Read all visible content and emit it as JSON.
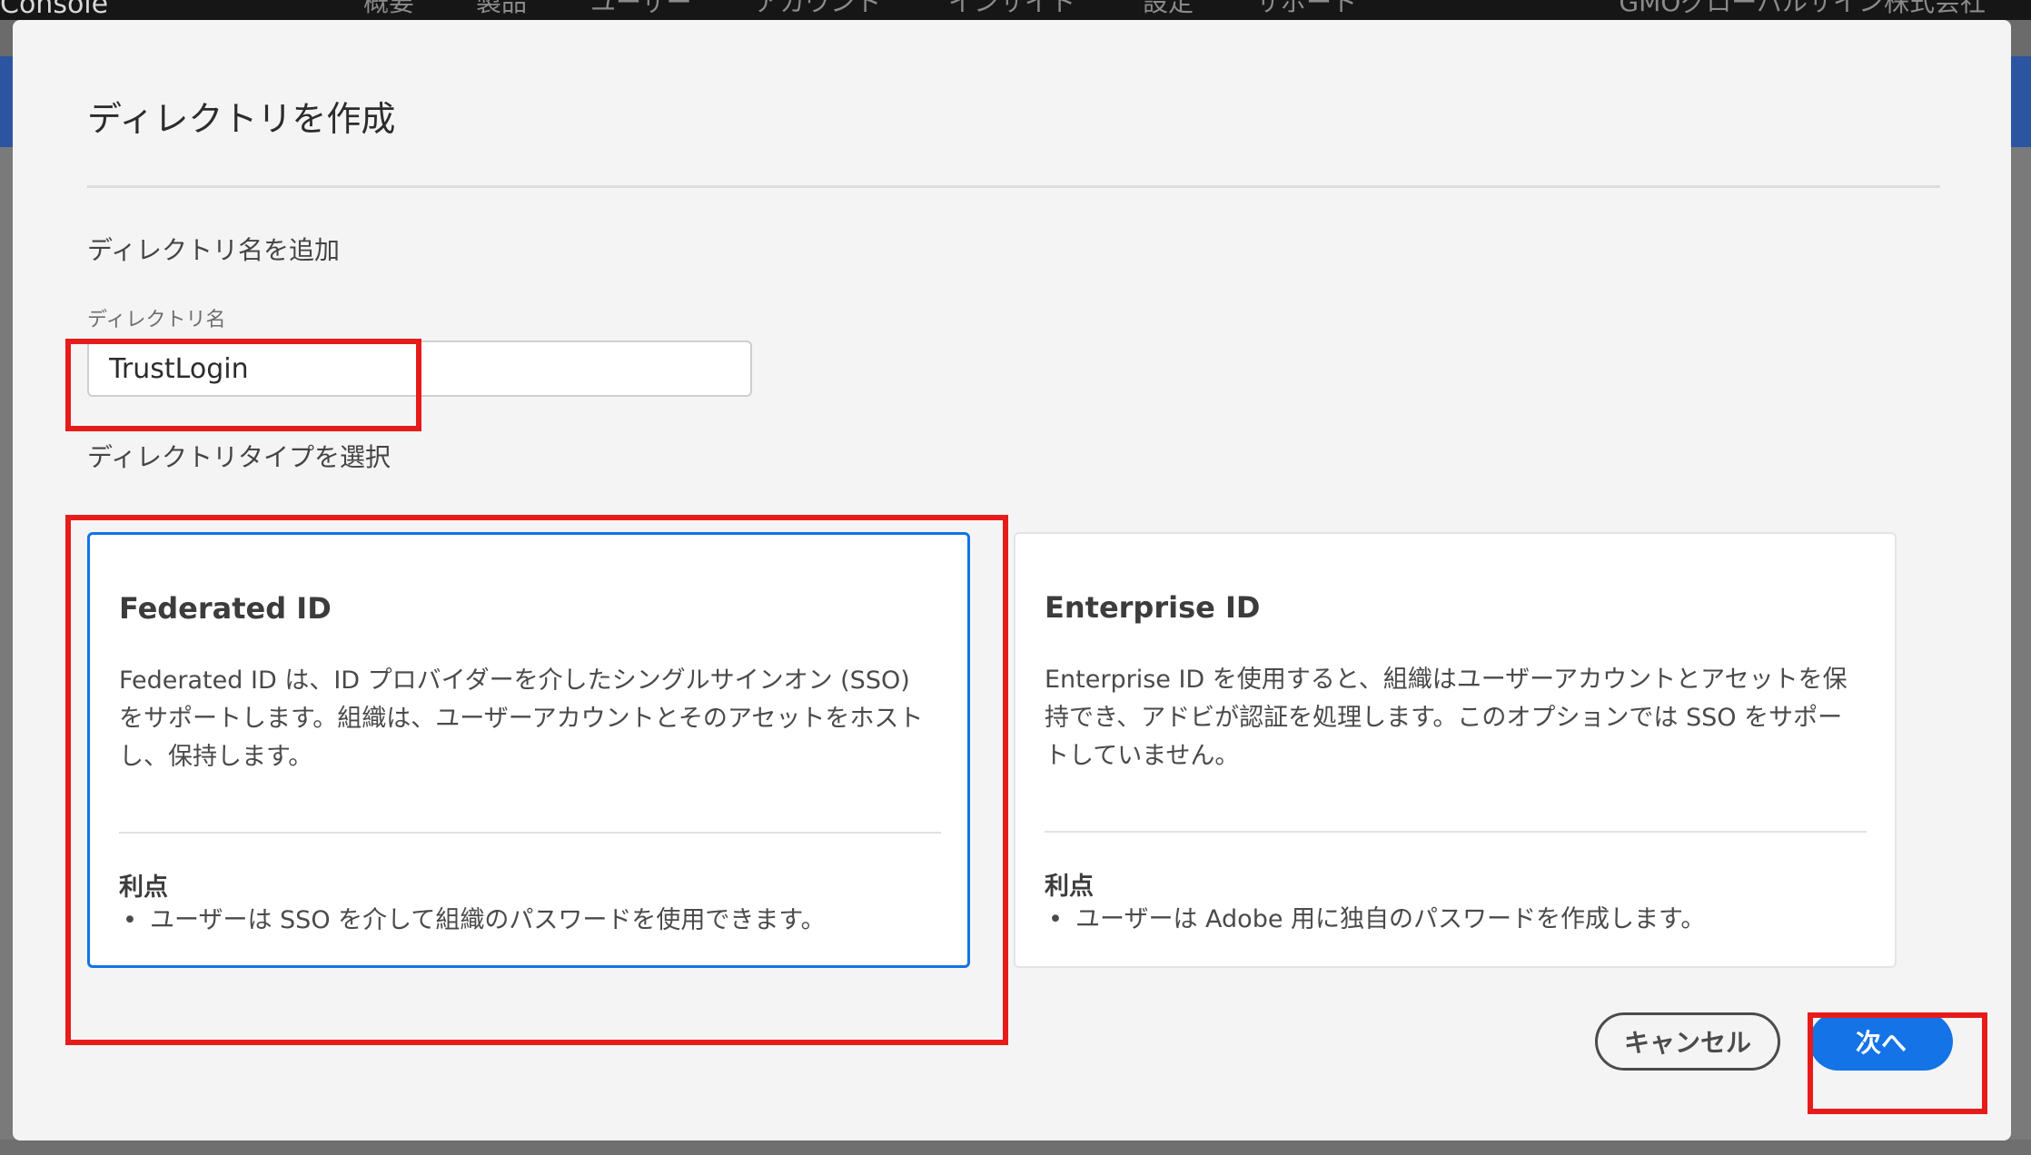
{
  "background": {
    "app_name": "Console",
    "nav": [
      "概要",
      "製品",
      "ユーザー",
      "アカウント",
      "インサイト",
      "設定",
      "サポート"
    ],
    "org_name": "GMOグローバルサイン株式会社"
  },
  "modal": {
    "title": "ディレクトリを作成",
    "name_section_heading": "ディレクトリ名を追加",
    "name_field": {
      "label": "ディレクトリ名",
      "value": "TrustLogin"
    },
    "type_section_heading": "ディレクトリタイプを選択",
    "cards": [
      {
        "title": "Federated ID",
        "description": "Federated ID は、ID プロバイダーを介したシングルサインオン (SSO) をサポートします。組織は、ユーザーアカウントとそのアセットをホストし、保持します。",
        "advantages_heading": "利点",
        "advantages": [
          "ユーザーは SSO を介して組織のパスワードを使用できます。"
        ],
        "selected": true
      },
      {
        "title": "Enterprise ID",
        "description": "Enterprise ID を使用すると、組織はユーザーアカウントとアセットを保持でき、アドビが認証を処理します。このオプションでは SSO をサポートしていません。",
        "advantages_heading": "利点",
        "advantages": [
          "ユーザーは Adobe 用に独自のパスワードを作成します。"
        ],
        "selected": false
      }
    ],
    "buttons": {
      "cancel": "キャンセル",
      "next": "次へ"
    }
  },
  "colors": {
    "accent": "#1473e6",
    "highlight": "#e81b1b"
  }
}
